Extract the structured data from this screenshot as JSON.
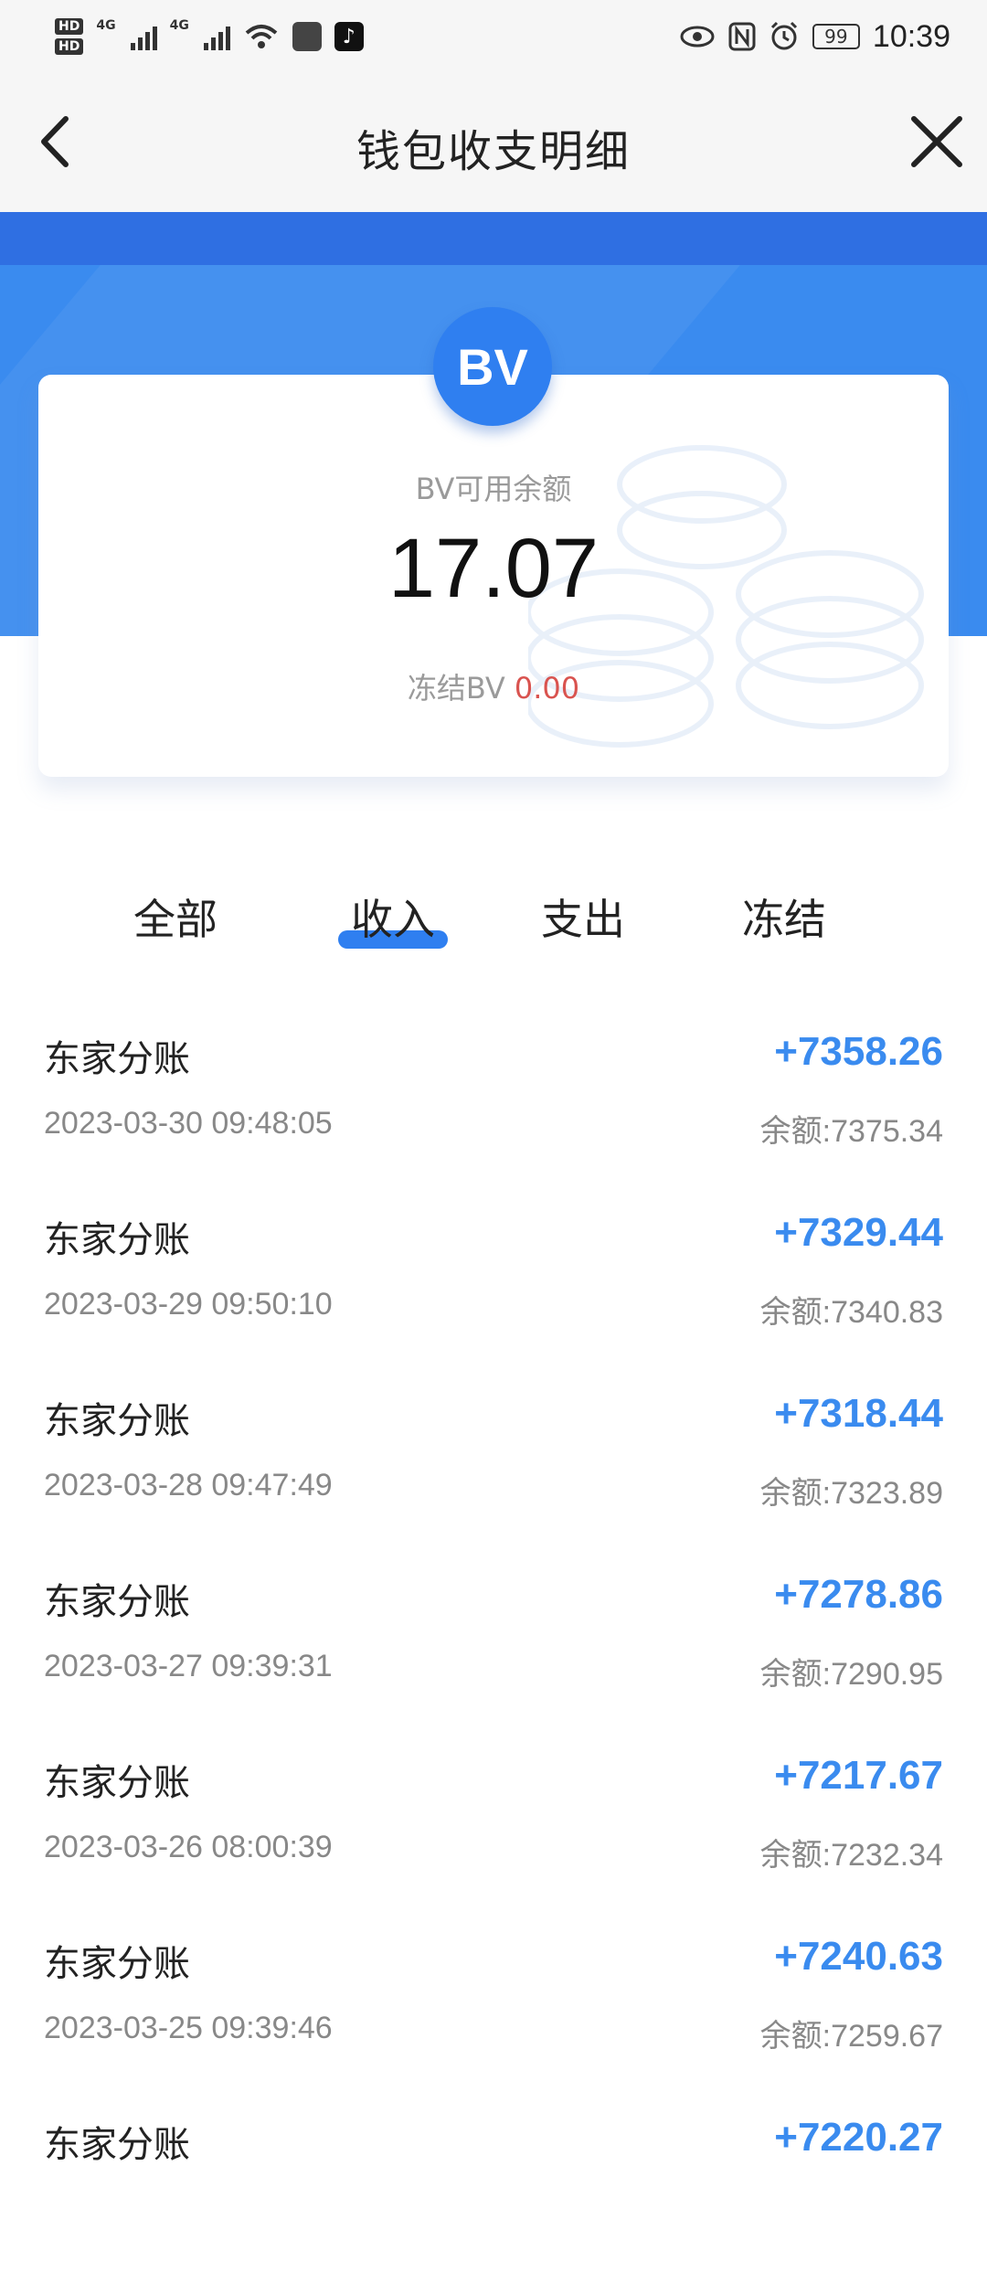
{
  "status_bar": {
    "hd1": "HD",
    "hd2": "HD",
    "net1": "4G",
    "net2": "4G",
    "battery": "99",
    "time": "10:39"
  },
  "header": {
    "title": "钱包收支明细"
  },
  "card": {
    "badge": "BV",
    "label": "BV可用余额",
    "amount": "17.07",
    "frozen_label": "冻结BV",
    "frozen_value": "0.00"
  },
  "tabs": [
    {
      "label": "全部"
    },
    {
      "label": "收入"
    },
    {
      "label": "支出"
    },
    {
      "label": "冻结"
    }
  ],
  "active_tab": "收入",
  "accent_color": "#3a8bef",
  "transactions": [
    {
      "title": "东家分账",
      "time": "2023-03-30 09:48:05",
      "amount": "+7358.26",
      "balance": "余额:7375.34"
    },
    {
      "title": "东家分账",
      "time": "2023-03-29 09:50:10",
      "amount": "+7329.44",
      "balance": "余额:7340.83"
    },
    {
      "title": "东家分账",
      "time": "2023-03-28 09:47:49",
      "amount": "+7318.44",
      "balance": "余额:7323.89"
    },
    {
      "title": "东家分账",
      "time": "2023-03-27 09:39:31",
      "amount": "+7278.86",
      "balance": "余额:7290.95"
    },
    {
      "title": "东家分账",
      "time": "2023-03-26 08:00:39",
      "amount": "+7217.67",
      "balance": "余额:7232.34"
    },
    {
      "title": "东家分账",
      "time": "2023-03-25 09:39:46",
      "amount": "+7240.63",
      "balance": "余额:7259.67"
    },
    {
      "title": "东家分账",
      "time": "",
      "amount": "+7220.27",
      "balance": ""
    }
  ]
}
